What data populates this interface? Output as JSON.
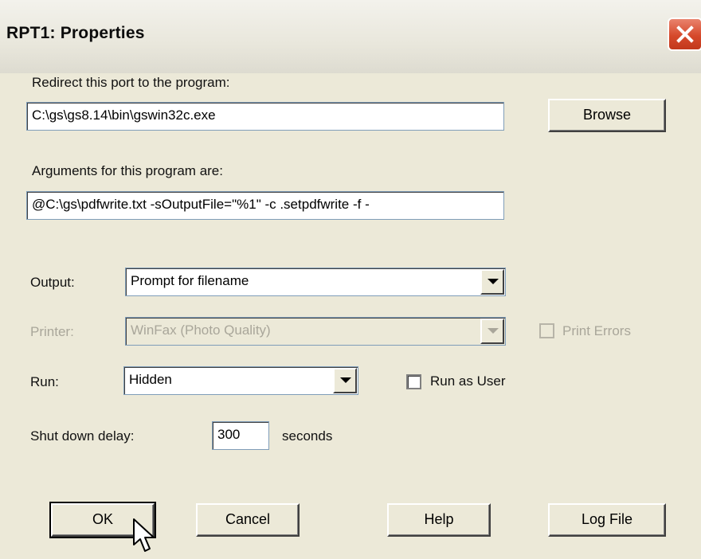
{
  "window": {
    "title": "RPT1: Properties"
  },
  "redirect": {
    "label": "Redirect this port to the program:",
    "program_path": "C:\\gs\\gs8.14\\bin\\gswin32c.exe",
    "browse_label": "Browse"
  },
  "arguments": {
    "label": "Arguments for this program are:",
    "value": "@C:\\gs\\pdfwrite.txt -sOutputFile=\"%1\" -c .setpdfwrite -f -"
  },
  "output": {
    "label": "Output:",
    "selected": "Prompt for filename"
  },
  "printer": {
    "label": "Printer:",
    "selected": "WinFax (Photo Quality)",
    "enabled": false,
    "print_errors_label": "Print Errors",
    "print_errors_checked": false
  },
  "run": {
    "label": "Run:",
    "selected": "Hidden",
    "run_as_user_label": "Run as User",
    "run_as_user_checked": false
  },
  "shutdown": {
    "label": "Shut down delay:",
    "value": "300",
    "unit": "seconds"
  },
  "buttons": {
    "ok": "OK",
    "cancel": "Cancel",
    "help": "Help",
    "log_file": "Log File"
  },
  "icons": {
    "close": "close-icon",
    "dropdown": "chevron-down-icon",
    "cursor": "mouse-pointer-icon"
  },
  "colors": {
    "dialog_background": "#ece9d8",
    "close_button": "#d6492b",
    "disabled_text": "#a9a69a"
  }
}
